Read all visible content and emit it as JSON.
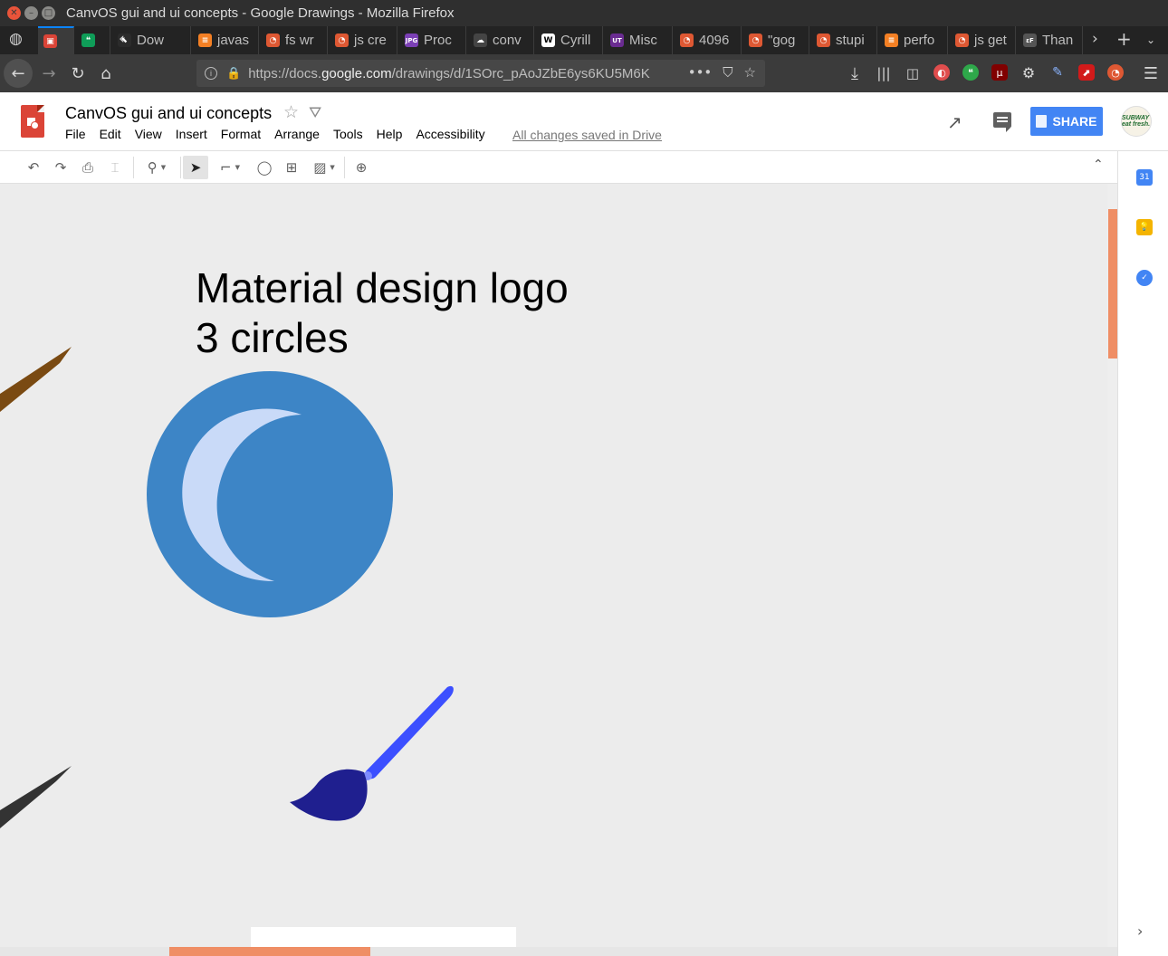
{
  "window": {
    "title": "CanvOS gui and ui concepts - Google Drawings - Mozilla Firefox"
  },
  "tabs": [
    {
      "label": "",
      "favicon": "google-drawings-icon",
      "color": "#db4437",
      "active": true
    },
    {
      "label": "",
      "favicon": "hangouts-icon",
      "color": "#0f9d58"
    },
    {
      "label": "Dow",
      "favicon": "arrow-icon",
      "color": "#2b2b2b"
    },
    {
      "label": "javas",
      "favicon": "stackoverflow-icon",
      "color": "#f48024"
    },
    {
      "label": "fs wr",
      "favicon": "duckduckgo-icon",
      "color": "#de5833"
    },
    {
      "label": "js cre",
      "favicon": "duckduckgo-icon",
      "color": "#de5833"
    },
    {
      "label": "Proc",
      "favicon": "jpg-icon",
      "color": "#7b3fb5"
    },
    {
      "label": "conv",
      "favicon": "cloud-icon",
      "color": "#444444"
    },
    {
      "label": "Cyrill",
      "favicon": "wikipedia-icon",
      "color": "#ffffff"
    },
    {
      "label": "Misc",
      "favicon": "ut-icon",
      "color": "#6a2c91"
    },
    {
      "label": "4096",
      "favicon": "duckduckgo-icon",
      "color": "#de5833"
    },
    {
      "label": "\"gog",
      "favicon": "duckduckgo-icon",
      "color": "#de5833"
    },
    {
      "label": "stupi",
      "favicon": "duckduckgo-icon",
      "color": "#de5833"
    },
    {
      "label": "perfo",
      "favicon": "stackoverflow-icon",
      "color": "#f48024"
    },
    {
      "label": "js get",
      "favicon": "duckduckgo-icon",
      "color": "#de5833"
    },
    {
      "label": "Than",
      "favicon": "ef-icon",
      "color": "#555555"
    }
  ],
  "nav": {
    "url_prefix": "https://docs.",
    "url_domain": "google.com",
    "url_rest": "/drawings/d/1SOrc_pAoJZbE6ys6KU5M6K"
  },
  "doc": {
    "title": "CanvOS gui and ui concepts",
    "menu": [
      "File",
      "Edit",
      "View",
      "Insert",
      "Format",
      "Arrange",
      "Tools",
      "Help",
      "Accessibility"
    ],
    "save_status": "All changes saved in Drive",
    "share_label": "SHARE",
    "avatar_text": "SUBWAY eat fresh."
  },
  "canvas": {
    "heading_line1": "Material design logo",
    "heading_line2": "3 circles",
    "circle_color": "#3d85c6",
    "crescent_color": "#c9daf8",
    "brush_handle_color": "#3c4fff",
    "brush_tip_color": "#1f1f8f"
  },
  "colors": {
    "share_blue": "#4285f4",
    "scroll_thumb": "#ef8e65"
  }
}
